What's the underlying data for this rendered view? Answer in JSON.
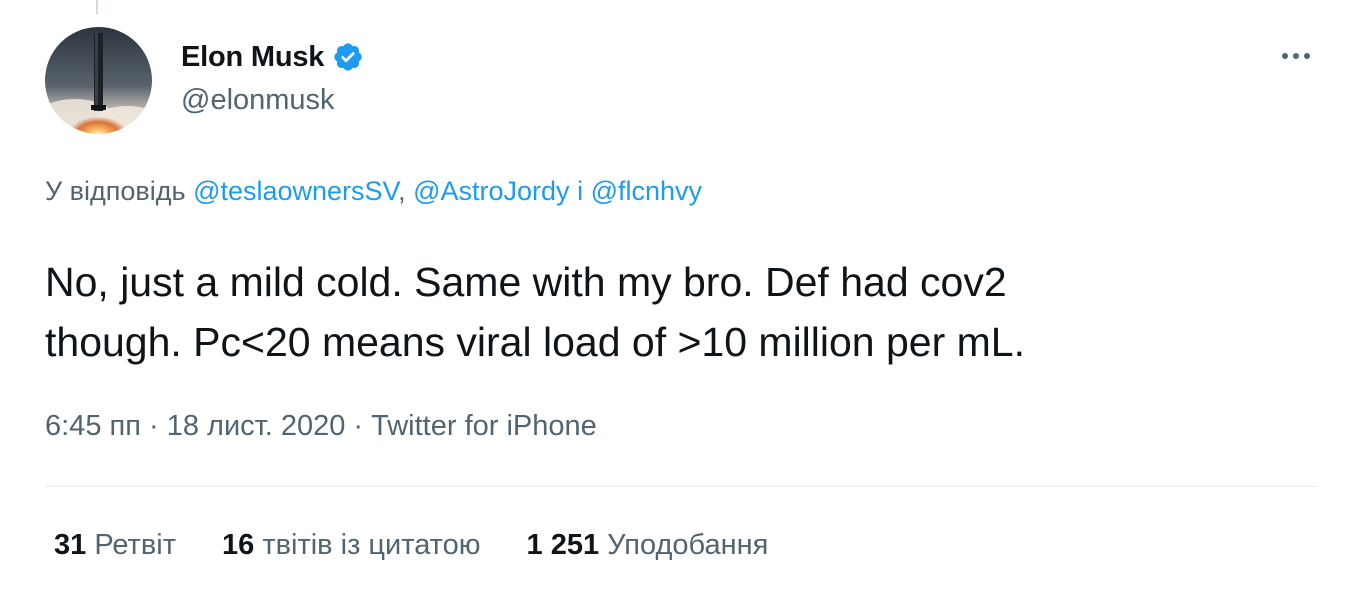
{
  "tweet": {
    "author": {
      "display_name": "Elon Musk",
      "handle": "@elonmusk",
      "verified_icon": "verified-badge-icon"
    },
    "reply": {
      "prefix": "У відповідь ",
      "mentions": [
        "@teslaownersSV",
        "@AstroJordy",
        "@flcnhvy"
      ],
      "separator_1": ", ",
      "separator_2": " і "
    },
    "text": "No, just a mild cold. Same with my bro. Def had cov2\nthough. Pc<20 means viral load of >10 million per mL.",
    "meta": {
      "time": "6:45 пп",
      "dot_1": " · ",
      "date": "18 лист. 2020",
      "dot_2": " · ",
      "source": "Twitter for iPhone"
    },
    "stats": {
      "retweets": {
        "count": "31",
        "label": "Ретвіт"
      },
      "quotes": {
        "count": "16",
        "label": "твітів із цитатою"
      },
      "likes": {
        "count": "1 251",
        "label": "Уподобання"
      }
    }
  },
  "colors": {
    "accent": "#1d9bf0",
    "text_primary": "#0f1419",
    "text_secondary": "#536471",
    "divider": "#e6ecf0"
  },
  "icons": {
    "more": "more-horizontal-icon"
  }
}
